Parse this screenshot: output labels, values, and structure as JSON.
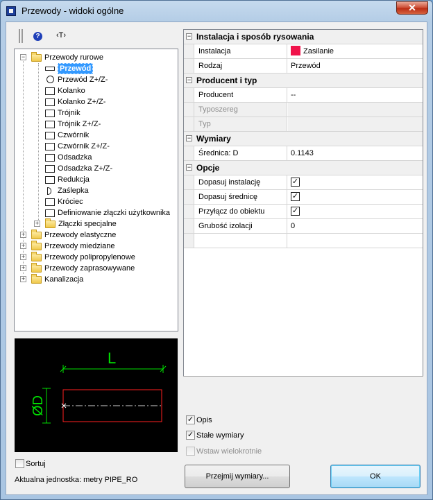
{
  "window": {
    "title": "Przewody - widoki ogólne",
    "close_glyph": "✕"
  },
  "toolbar": {
    "help_glyph": "?",
    "text_glyph": "‹T›"
  },
  "tree": {
    "root": {
      "label": "Przewody rurowe"
    },
    "children": [
      {
        "label": "Przewód",
        "selected": true
      },
      {
        "label": "Przewód Z+/Z-"
      },
      {
        "label": "Kolanko"
      },
      {
        "label": "Kolanko Z+/Z-"
      },
      {
        "label": "Trójnik"
      },
      {
        "label": "Trójnik Z+/Z-"
      },
      {
        "label": "Czwórnik"
      },
      {
        "label": "Czwórnik Z+/Z-"
      },
      {
        "label": "Odsadzka"
      },
      {
        "label": "Odsadzka Z+/Z-"
      },
      {
        "label": "Redukcja"
      },
      {
        "label": "Zaślepka"
      },
      {
        "label": "Króciec"
      },
      {
        "label": "Definiowanie złączki użytkownika"
      },
      {
        "label": "Złączki specjalne"
      }
    ],
    "others": [
      {
        "label": "Przewody elastyczne"
      },
      {
        "label": "Przewody miedziane"
      },
      {
        "label": "Przewody polipropylenowe"
      },
      {
        "label": "Przewody zaprasowywane"
      },
      {
        "label": "Kanalizacja"
      }
    ]
  },
  "preview": {
    "dim_label_L": "L",
    "dim_label_D": "ØD"
  },
  "properties": {
    "cat1": "Instalacja i sposób rysowania",
    "instalacja": {
      "name": "Instalacja",
      "value": "Zasilanie",
      "color": "#f0124a"
    },
    "rodzaj": {
      "name": "Rodzaj",
      "value": "Przewód"
    },
    "cat2": "Producent i typ",
    "producent": {
      "name": "Producent",
      "value": "--"
    },
    "typoszereg": {
      "name": "Typoszereg",
      "value": ""
    },
    "typ": {
      "name": "Typ",
      "value": ""
    },
    "cat3": "Wymiary",
    "srednica": {
      "name": "Średnica: D",
      "value": "0.1143"
    },
    "cat4": "Opcje",
    "dopasuj_inst": {
      "name": "Dopasuj instalację",
      "checked": true
    },
    "dopasuj_sred": {
      "name": "Dopasuj średnicę",
      "checked": true
    },
    "przylacz": {
      "name": "Przyłącz do obiektu",
      "checked": true
    },
    "grubosc": {
      "name": "Grubość izolacji",
      "value": "0"
    },
    "toggle_glyph": "−"
  },
  "options": {
    "opis": "Opis",
    "stale": "Stałe wymiary",
    "wstaw": "Wstaw wielokrotnie",
    "check_glyph": "✓"
  },
  "footer": {
    "sortuj": "Sortuj",
    "unit": "Aktualna jednostka: metry  PIPE_RO",
    "przejmij": "Przejmij wymiary...",
    "ok": "OK"
  }
}
